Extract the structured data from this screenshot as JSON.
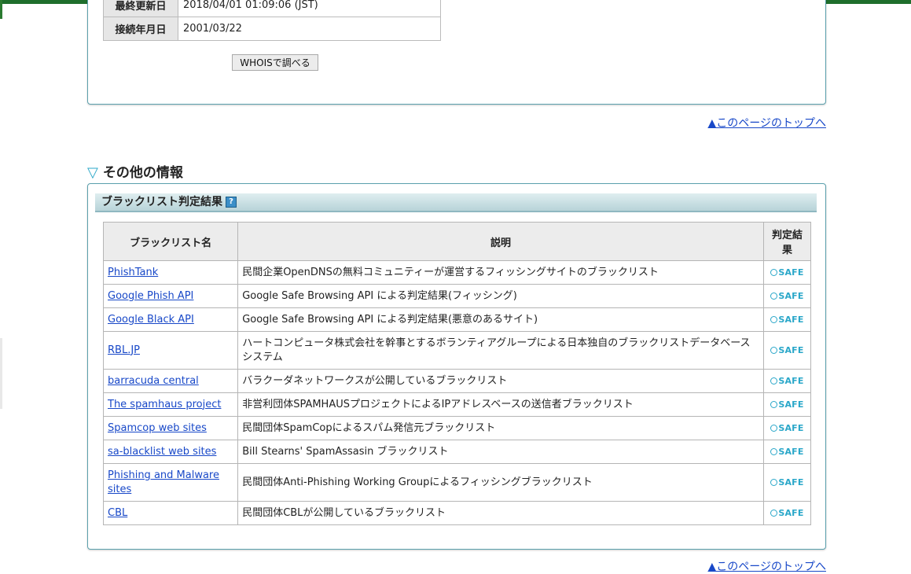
{
  "whois": {
    "rows": [
      {
        "label": "最終更新日",
        "value": "2018/04/01 01:09:06 (JST)"
      },
      {
        "label": "接続年月日",
        "value": "2001/03/22"
      }
    ],
    "button_label": "WHOISで調べる"
  },
  "page_top_link": "▲このページのトップへ",
  "section": {
    "title": "その他の情報",
    "subheader": "ブラックリスト判定結果",
    "help_icon_label": "?"
  },
  "table": {
    "headers": [
      "ブラックリスト名",
      "説明",
      "判定結果"
    ],
    "rows": [
      {
        "name": "PhishTank",
        "desc": "民間企業OpenDNSの無料コミュニティーが運営するフィッシングサイトのブラックリスト",
        "result": "SAFE"
      },
      {
        "name": "Google Phish API",
        "desc": "Google Safe Browsing API による判定結果(フィッシング)",
        "result": "SAFE"
      },
      {
        "name": "Google Black API",
        "desc": "Google Safe Browsing API による判定結果(悪意のあるサイト)",
        "result": "SAFE"
      },
      {
        "name": "RBL.JP",
        "desc": "ハートコンピュータ株式会社を幹事とするボランティアグループによる日本独自のブラックリストデータベースシステム",
        "result": "SAFE"
      },
      {
        "name": "barracuda central",
        "desc": "バラクーダネットワークスが公開しているブラックリスト",
        "result": "SAFE"
      },
      {
        "name": "The spamhaus project",
        "desc": "非営利団体SPAMHAUSプロジェクトによるIPアドレスベースの送信者ブラックリスト",
        "result": "SAFE"
      },
      {
        "name": "Spamcop web sites",
        "desc": "民間団体SpamCopによるスパム発信元ブラックリスト",
        "result": "SAFE"
      },
      {
        "name": "sa-blacklist web sites",
        "desc": "Bill Stearns' SpamAssasin ブラックリスト",
        "result": "SAFE"
      },
      {
        "name": "Phishing and Malware sites",
        "desc": "民間団体Anti-Phishing Working Groupによるフィッシングブラックリスト",
        "result": "SAFE"
      },
      {
        "name": "CBL",
        "desc": "民間団体CBLが公開しているブラックリスト",
        "result": "SAFE"
      }
    ]
  },
  "colors": {
    "accent": "#2aa7c9",
    "link": "#1848c8",
    "panel_border": "#5ba0ad"
  }
}
